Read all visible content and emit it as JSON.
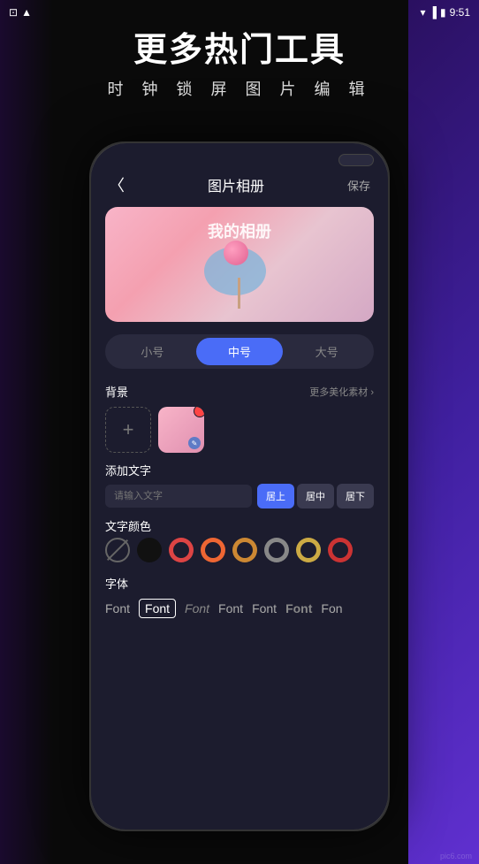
{
  "statusBar": {
    "time": "9:51",
    "leftIcons": [
      "android",
      "notification"
    ],
    "rightIcons": [
      "wifi",
      "signal",
      "battery"
    ]
  },
  "header": {
    "mainTitle": "更多热门工具",
    "subTitle": "时 钟 锁 屏 图 片 编 辑"
  },
  "phone": {
    "navBack": "〈",
    "navTitle": "图片相册",
    "navSave": "保存",
    "previewText": "我的相册",
    "sizeBtns": [
      {
        "label": "小号",
        "active": false
      },
      {
        "label": "中号",
        "active": true
      },
      {
        "label": "大号",
        "active": false
      }
    ],
    "backgroundSection": {
      "label": "背景",
      "link": "更多美化素材 ›"
    },
    "addTextSection": {
      "label": "添加文字",
      "placeholder": "请输入文字",
      "positions": [
        {
          "label": "居上",
          "active": true
        },
        {
          "label": "居中",
          "active": false
        },
        {
          "label": "居下",
          "active": false
        }
      ]
    },
    "colorSection": {
      "label": "文字颜色",
      "colors": [
        {
          "type": "none",
          "bg": "none"
        },
        {
          "type": "solid",
          "bg": "#111111"
        },
        {
          "type": "ring",
          "outer": "#dd4444",
          "inner": "#dd4444"
        },
        {
          "type": "ring",
          "outer": "#ee6633",
          "inner": "#ee6633"
        },
        {
          "type": "ring",
          "outer": "#cc8833",
          "inner": "#cc8833"
        },
        {
          "type": "ring",
          "outer": "#888888",
          "inner": "#888888"
        },
        {
          "type": "ring",
          "outer": "#ccaa44",
          "inner": "#ccaa44"
        },
        {
          "type": "ring",
          "outer": "#cc3333",
          "inner": "#cc3333"
        }
      ]
    },
    "fontSection": {
      "label": "字体",
      "fonts": [
        {
          "label": "Font",
          "style": "normal",
          "active": false
        },
        {
          "label": "Font",
          "style": "normal",
          "active": true
        },
        {
          "label": "Font",
          "style": "italic",
          "active": false
        },
        {
          "label": "Font",
          "style": "normal",
          "active": false
        },
        {
          "label": "Font",
          "style": "normal",
          "active": false
        },
        {
          "label": "Font",
          "style": "bold",
          "active": false
        },
        {
          "label": "Fon",
          "style": "normal",
          "active": false
        }
      ]
    }
  },
  "watermark": "pic6.com"
}
